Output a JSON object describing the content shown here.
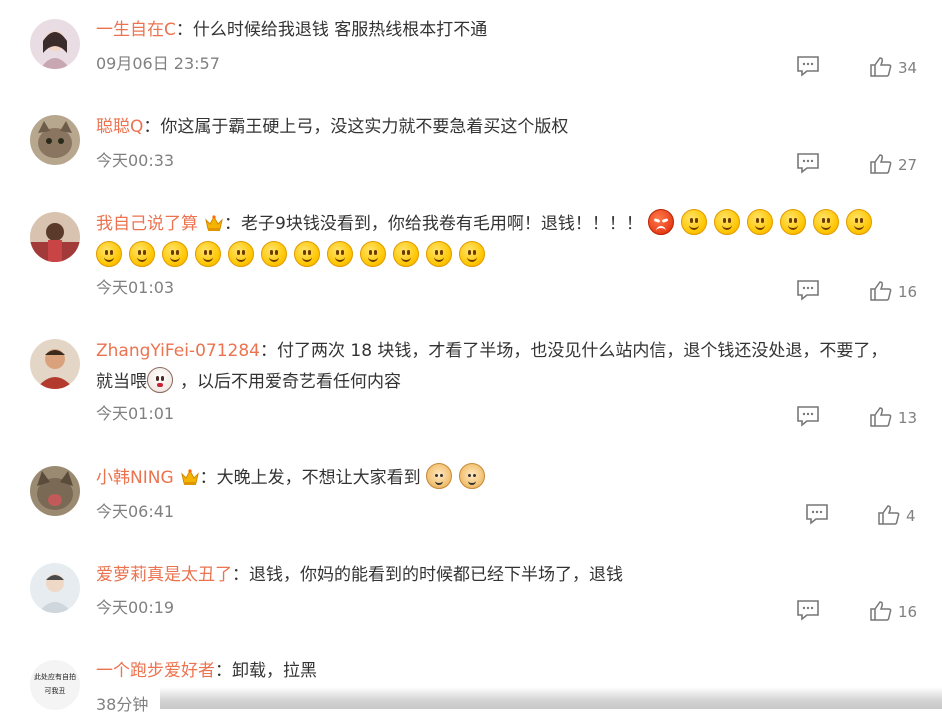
{
  "comments": [
    {
      "username": "一生自在C",
      "colon": "：",
      "text": "什么时候给我退钱 客服热线根本打不通",
      "time": "09月06日 23:57",
      "likes": "34",
      "avatar_color": "#c9a7b2"
    },
    {
      "username": "聪聪Q",
      "colon": "：",
      "text": "你这属于霸王硬上弓，没这实力就不要急着买这个版权",
      "time": "今天00:33",
      "likes": "27",
      "avatar_color": "#8a7660"
    },
    {
      "username": "我自己说了算",
      "colon": "：",
      "text": "老子9块钱没看到，你给我卷有毛用啊！退钱！！！！",
      "time": "今天01:03",
      "likes": "16",
      "avatar_color": "#a23a3a"
    },
    {
      "username": "ZhangYiFei-071284",
      "colon": "：",
      "text": "付了两次 18 块钱，才看了半场，也没见什么站内信，退个钱还没处退，不要了，",
      "text2a": "就当喂",
      "text2b": "，以后不用爱奇艺看任何内容",
      "time": "今天01:01",
      "likes": "13",
      "avatar_color": "#b23b2e"
    },
    {
      "username": "小韩NING",
      "colon": "：",
      "text": "大晚上发，不想让大家看到",
      "time": "今天06:41",
      "likes": "4",
      "avatar_color": "#7a6a55"
    },
    {
      "username": "爱萝莉真是太丑了",
      "colon": "：",
      "text": "退钱，你妈的能看到的时候都已经下半场了，退钱",
      "time": "今天00:19",
      "likes": "16",
      "avatar_color": "#cfd6dc"
    },
    {
      "username": "一个跑步爱好者",
      "colon": "：",
      "text": "卸载，拉黑",
      "time": "38分钟",
      "avatar_text_1": "此处应有自拍",
      "avatar_text_2": "可我丑"
    }
  ],
  "icons": {
    "reply": "comment-reply-icon",
    "like": "thumbs-up-icon",
    "crown": "vip-crown-icon"
  },
  "colors": {
    "username": "#eb7350",
    "text": "#333333",
    "meta": "#808080"
  }
}
